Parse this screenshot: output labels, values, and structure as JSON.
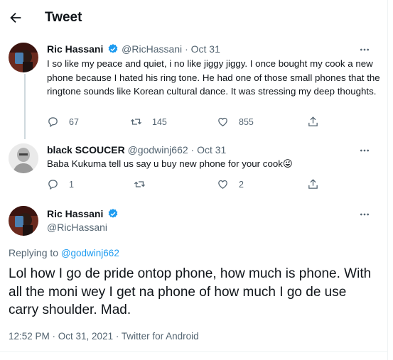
{
  "header": {
    "title": "Tweet"
  },
  "parent_tweet": {
    "name": "Ric Hassani",
    "handle": "@RicHassani",
    "sep": "·",
    "date": "Oct 31",
    "text": "I so like my peace and quiet, i no like jiggy jiggy. I once bought my cook a new phone because I hated his ring tone. He had one of those small phones that the ringtone sounds like Korean cultural dance. It was stressing my deep thoughts.",
    "replies": "67",
    "retweets": "145",
    "likes": "855"
  },
  "reply_tweet": {
    "name": "black SCOUCER",
    "handle": "@godwinj662",
    "sep": "·",
    "date": "Oct 31",
    "text": "Baba Kukuma tell us say u buy new phone for your cook",
    "emoji": "😜",
    "replies": "1",
    "retweets": "",
    "likes": "2"
  },
  "main_tweet": {
    "name": "Ric Hassani",
    "handle": "@RicHassani",
    "replying_prefix": "Replying to",
    "replying_to": "@godwinj662",
    "text": "Lol how I go de pride ontop phone, how much is phone. With all the moni wey I get na phone of how much I go de use carry shoulder. Mad.",
    "meta": "12:52 PM · Oct 31, 2021 · Twitter for Android"
  },
  "colors": {
    "accent": "#1d9bf0",
    "secondary": "#536471",
    "text": "#0f1419"
  },
  "icons": [
    "back-arrow-icon",
    "verified-badge-icon",
    "more-icon",
    "reply-icon",
    "retweet-icon",
    "like-icon",
    "share-icon"
  ]
}
